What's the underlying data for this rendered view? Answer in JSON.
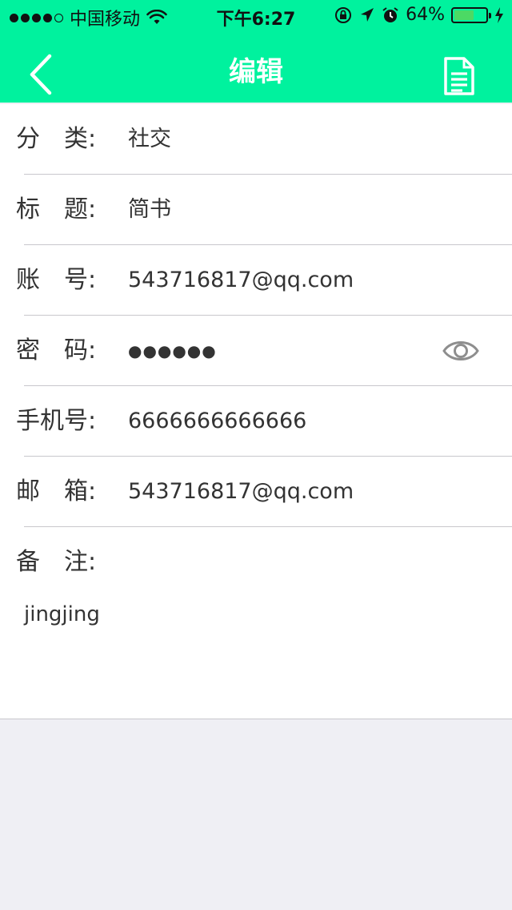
{
  "status_bar": {
    "carrier": "中国移动",
    "time": "下午6:27",
    "battery": "64%",
    "battery_level": 0.64
  },
  "nav": {
    "title": "编辑",
    "back_icon": "chevron-left-icon",
    "action_icon": "document-icon"
  },
  "form": {
    "fields": [
      {
        "label": "分　类:",
        "value": "社交"
      },
      {
        "label": "标　题:",
        "value": "简书"
      },
      {
        "label": "账　号:",
        "value": "543716817@qq.com"
      },
      {
        "label": "密　码:",
        "value": "●●●●●●"
      },
      {
        "label": "手机号:",
        "value": "6666666666666"
      },
      {
        "label": "邮　箱:",
        "value": "543716817@qq.com"
      },
      {
        "label": "备　注:",
        "value": "jingjing"
      }
    ]
  },
  "colors": {
    "header": "#00f29e",
    "background": "#efeff4"
  }
}
